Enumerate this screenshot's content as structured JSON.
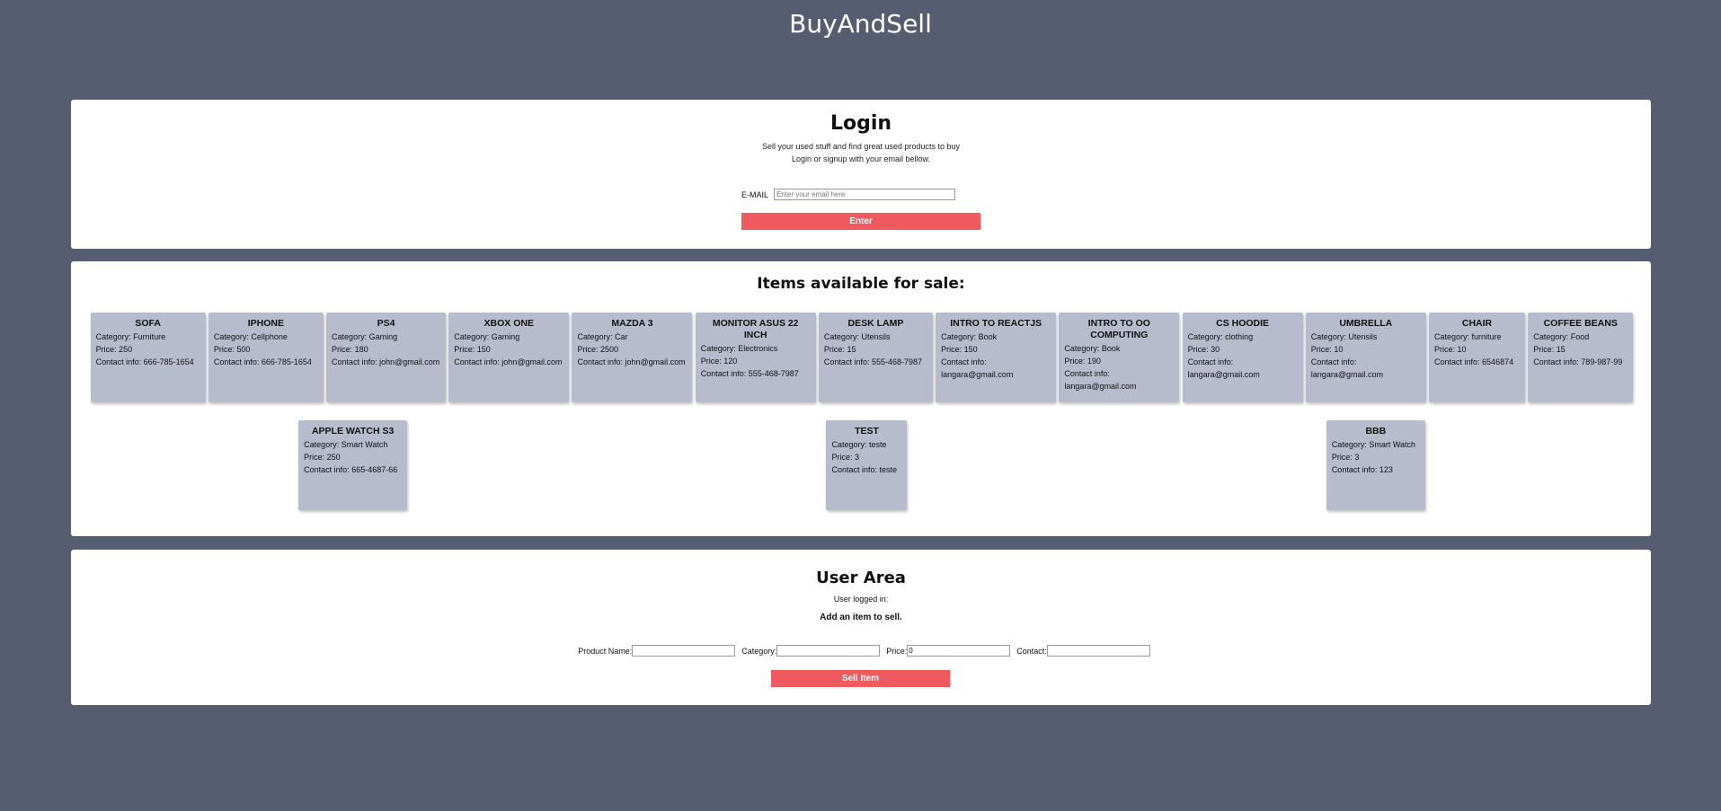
{
  "app": {
    "title": "BuyAndSell"
  },
  "login": {
    "heading": "Login",
    "subtitle_1": "Sell your used stuff and find great used products to buy",
    "subtitle_2": "Login or signup with your email bellow.",
    "email_label": "E-MAIL",
    "email_placeholder": "Enter your email here",
    "email_value": "",
    "enter_label": "Enter"
  },
  "items": {
    "heading": "Items available for sale:",
    "category_prefix": "Category: ",
    "price_prefix": "Price: ",
    "contact_prefix": "Contact info: ",
    "list": [
      {
        "name": "SOFA",
        "category": "Furniture",
        "price": "250",
        "contact": "666-785-1654"
      },
      {
        "name": "IPHONE",
        "category": "Cellphone",
        "price": "500",
        "contact": "666-785-1654"
      },
      {
        "name": "PS4",
        "category": "Gaming",
        "price": "180",
        "contact": "john@gmail.com"
      },
      {
        "name": "XBOX ONE",
        "category": "Gaming",
        "price": "150",
        "contact": "john@gmail.com"
      },
      {
        "name": "MAZDA 3",
        "category": "Car",
        "price": "2500",
        "contact": "john@gmail.com"
      },
      {
        "name": "MONITOR ASUS 22 INCH",
        "category": "Electronics",
        "price": "120",
        "contact": "555-468-7987"
      },
      {
        "name": "DESK LAMP",
        "category": "Utensils",
        "price": "15",
        "contact": "555-468-7987"
      },
      {
        "name": "INTRO TO REACTJS",
        "category": "Book",
        "price": "150",
        "contact": "langara@gmail.com"
      },
      {
        "name": "INTRO TO OO COMPUTING",
        "category": "Book",
        "price": "190",
        "contact": "langara@gmail.com"
      },
      {
        "name": "CS HOODIE",
        "category": "clothing",
        "price": "30",
        "contact": "langara@gmail.com"
      },
      {
        "name": "UMBRELLA",
        "category": "Utensils",
        "price": "10",
        "contact": "langara@gmail.com"
      },
      {
        "name": "CHAIR",
        "category": "furniture",
        "price": "10",
        "contact": "6546874"
      },
      {
        "name": "COFFEE BEANS",
        "category": "Food",
        "price": "15",
        "contact": "789-987-99"
      },
      {
        "name": "APPLE WATCH S3",
        "category": "Smart Watch",
        "price": "250",
        "contact": "665-4687-66"
      },
      {
        "name": "TEST",
        "category": "teste",
        "price": "3",
        "contact": "teste"
      },
      {
        "name": "BBB",
        "category": "Smart Watch",
        "price": "3",
        "contact": "123"
      }
    ]
  },
  "user_area": {
    "heading": "User Area",
    "logged_in_label": "User logged in:",
    "add_item_label": "Add an item to sell.",
    "product_name_label": "Product Name:",
    "product_name_value": "",
    "category_label": "Category:",
    "category_value": "",
    "price_label": "Price:",
    "price_value": "0",
    "contact_label": "Contact:",
    "contact_value": "",
    "sell_label": "Sell Item"
  },
  "colors": {
    "background": "#575d70",
    "panel": "#ffffff",
    "card": "#b6bccc",
    "accent": "#f05a5f"
  }
}
